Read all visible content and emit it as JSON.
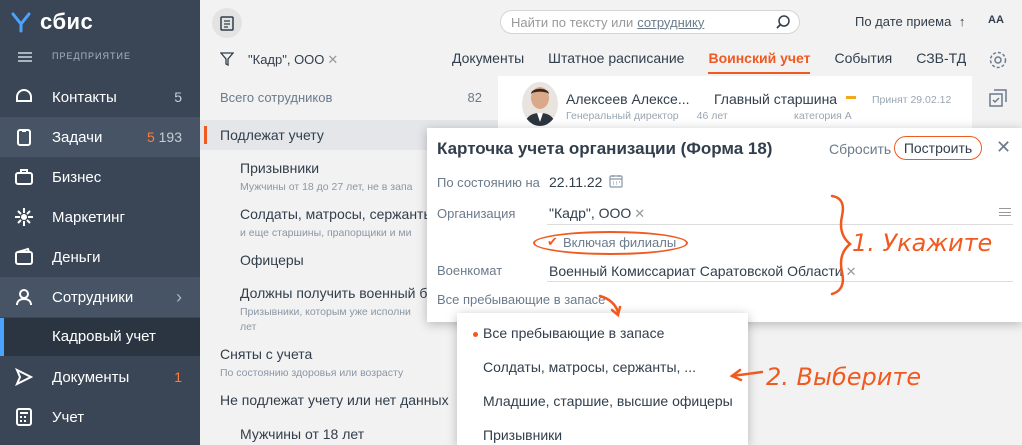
{
  "app": {
    "logo_text": "сбис",
    "org_label": "ПРЕДПРИЯТИЕ"
  },
  "sidebar": {
    "items": [
      {
        "label": "Контакты",
        "count": "5",
        "icon": "contacts-icon"
      },
      {
        "label": "Задачи",
        "count_warn": "5",
        "count": "193",
        "icon": "tasks-icon"
      },
      {
        "label": "Бизнес",
        "icon": "business-icon"
      },
      {
        "label": "Маркетинг",
        "icon": "marketing-icon"
      },
      {
        "label": "Деньги",
        "icon": "money-icon"
      },
      {
        "label": "Сотрудники",
        "icon": "employees-icon"
      },
      {
        "label": "Кадровый учет"
      },
      {
        "label": "Документы",
        "count": "1",
        "icon": "documents-icon"
      },
      {
        "label": "Учет",
        "icon": "accounting-icon"
      }
    ]
  },
  "header": {
    "search_placeholder": "Найти по тексту или",
    "search_link": "сотруднику",
    "sort_label": "По дате приема",
    "sort_arrow": "↑",
    "font_toggle": "АА"
  },
  "filter": {
    "chip": "\"Кадр\", ООО",
    "chip_remove": "✕"
  },
  "tabs": [
    {
      "label": "Документы"
    },
    {
      "label": "Штатное расписание"
    },
    {
      "label": "Воинский учет",
      "active": true
    },
    {
      "label": "События"
    },
    {
      "label": "СЗВ-ТД"
    }
  ],
  "list": {
    "total_label": "Всего сотрудников",
    "total_count": "82",
    "header": "Подлежат учету",
    "items": [
      {
        "title": "Призывники",
        "sub": "Мужчины от 18 до 27 лет, не в запа"
      },
      {
        "title": "Солдаты, матросы, сержанты",
        "sub": "и еще старшины, прапорщики и ми"
      },
      {
        "title": "Офицеры"
      },
      {
        "title": "Должны получить военный б",
        "sub": "Призывники, которым уже исполни",
        "sub2": "лет"
      },
      {
        "title": "Сняты с учета",
        "sub": "По состоянию здоровья или возрасту"
      },
      {
        "title": "Не подлежат учету или нет данных"
      },
      {
        "title": "Мужчины от 18 лет"
      }
    ]
  },
  "employee": {
    "name": "Алексеев Алексе...",
    "role": "Генеральный директор",
    "age": "46 лет",
    "position": "Главный старшина",
    "category": "категория А",
    "hired": "Принят 29.02.12"
  },
  "dialog": {
    "title": "Карточка учета организации (Форма 18)",
    "reset": "Сбросить",
    "build": "Построить",
    "close": "✕",
    "date_label": "По состоянию на",
    "date_value": "22.11.22",
    "org_label": "Организация",
    "org_value": "\"Кадр\", ООО",
    "branches": "Включая филиалы",
    "commissariat_label": "Военкомат",
    "commissariat_value": "Военный Комиссариат Саратовской Области",
    "reserve_select": "Все пребывающие в запасе"
  },
  "dropdown": {
    "options": [
      "Все пребывающие в запасе",
      "Солдаты, матросы, сержанты, ...",
      "Младшие, старшие, высшие офицеры",
      "Призывники"
    ],
    "selected_index": 0
  },
  "annotations": {
    "step1": "1. Укажите",
    "step2": "2. Выберите"
  },
  "colors": {
    "accent": "#f05a20",
    "sidebar": "#3a4656",
    "text": "#313e4c"
  }
}
